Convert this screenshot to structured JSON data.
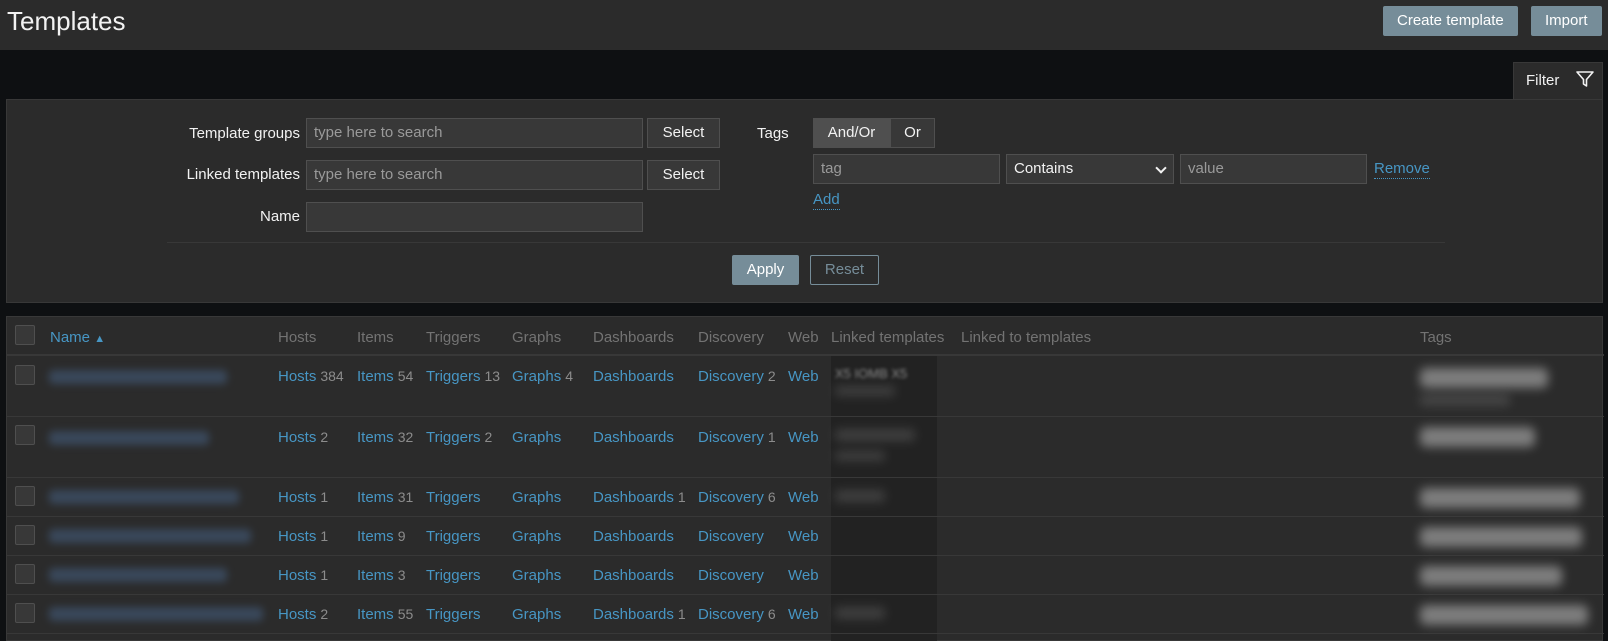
{
  "header": {
    "title": "Templates",
    "create_label": "Create template",
    "import_label": "Import"
  },
  "filter": {
    "tab_label": "Filter",
    "template_groups_label": "Template groups",
    "template_groups_placeholder": "type here to search",
    "linked_templates_label": "Linked templates",
    "linked_templates_placeholder": "type here to search",
    "select_label": "Select",
    "name_label": "Name",
    "name_value": "",
    "tags_label": "Tags",
    "and_or_label": "And/Or",
    "or_label": "Or",
    "tag_placeholder": "tag",
    "operator_value": "Contains",
    "value_placeholder": "value",
    "remove_label": "Remove",
    "add_label": "Add",
    "apply_label": "Apply",
    "reset_label": "Reset"
  },
  "table": {
    "columns": [
      "Name",
      "Hosts",
      "Items",
      "Triggers",
      "Graphs",
      "Dashboards",
      "Discovery",
      "Web",
      "Linked templates",
      "Linked to templates",
      "Tags"
    ],
    "sort_indicator": "▲",
    "linked_partial": "X5 IOMB X5",
    "rows": [
      {
        "hosts": "Hosts",
        "hosts_n": "384",
        "items": "Items",
        "items_n": "54",
        "triggers": "Triggers",
        "triggers_n": "13",
        "graphs": "Graphs",
        "graphs_n": "4",
        "dashboards": "Dashboards",
        "dashboards_n": "",
        "discovery": "Discovery",
        "discovery_n": "2",
        "web": "Web"
      },
      {
        "hosts": "Hosts",
        "hosts_n": "2",
        "items": "Items",
        "items_n": "32",
        "triggers": "Triggers",
        "triggers_n": "2",
        "graphs": "Graphs",
        "graphs_n": "",
        "dashboards": "Dashboards",
        "dashboards_n": "",
        "discovery": "Discovery",
        "discovery_n": "1",
        "web": "Web"
      },
      {
        "hosts": "Hosts",
        "hosts_n": "1",
        "items": "Items",
        "items_n": "31",
        "triggers": "Triggers",
        "triggers_n": "",
        "graphs": "Graphs",
        "graphs_n": "",
        "dashboards": "Dashboards",
        "dashboards_n": "1",
        "discovery": "Discovery",
        "discovery_n": "6",
        "web": "Web"
      },
      {
        "hosts": "Hosts",
        "hosts_n": "1",
        "items": "Items",
        "items_n": "9",
        "triggers": "Triggers",
        "triggers_n": "",
        "graphs": "Graphs",
        "graphs_n": "",
        "dashboards": "Dashboards",
        "dashboards_n": "",
        "discovery": "Discovery",
        "discovery_n": "",
        "web": "Web"
      },
      {
        "hosts": "Hosts",
        "hosts_n": "1",
        "items": "Items",
        "items_n": "3",
        "triggers": "Triggers",
        "triggers_n": "",
        "graphs": "Graphs",
        "graphs_n": "",
        "dashboards": "Dashboards",
        "dashboards_n": "",
        "discovery": "Discovery",
        "discovery_n": "",
        "web": "Web"
      },
      {
        "hosts": "Hosts",
        "hosts_n": "2",
        "items": "Items",
        "items_n": "55",
        "triggers": "Triggers",
        "triggers_n": "",
        "graphs": "Graphs",
        "graphs_n": "",
        "dashboards": "Dashboards",
        "dashboards_n": "1",
        "discovery": "Discovery",
        "discovery_n": "6",
        "web": "Web"
      }
    ]
  },
  "colors": {
    "accent": "#4796c4",
    "button": "#768d99",
    "panel": "#2b2b2b",
    "page_bg": "#0e1012"
  }
}
